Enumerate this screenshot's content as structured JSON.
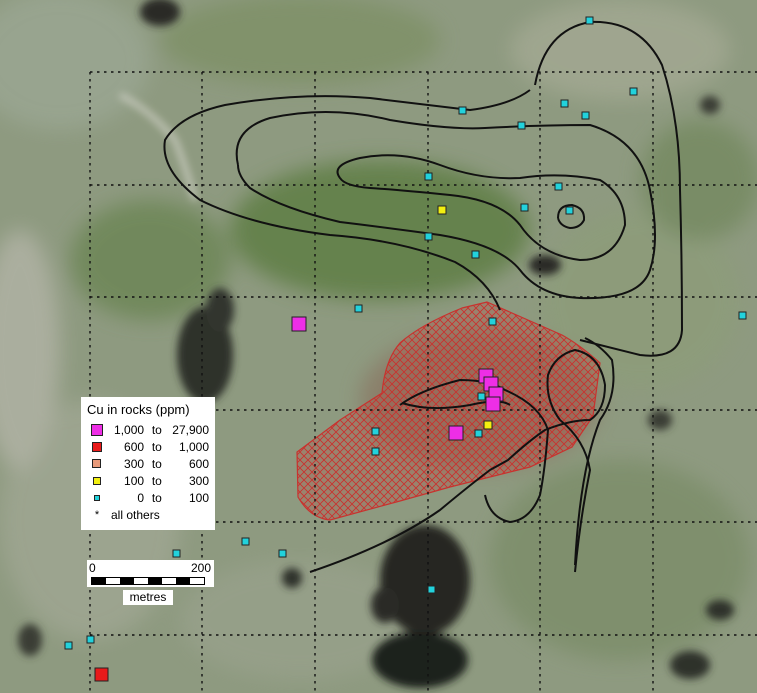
{
  "legend": {
    "title": "Cu in rocks (ppm)",
    "classes": [
      {
        "low": "1,000",
        "sep": "to",
        "high": "27,900",
        "color": "#ee2ee6"
      },
      {
        "low": "600",
        "sep": "to",
        "high": "1,000",
        "color": "#e81a1a"
      },
      {
        "low": "300",
        "sep": "to",
        "high": "600",
        "color": "#e89a7a"
      },
      {
        "low": "100",
        "sep": "to",
        "high": "300",
        "color": "#f2ef10"
      },
      {
        "low": "0",
        "sep": "to",
        "high": "100",
        "color": "#22d2dc"
      }
    ],
    "others_label": "all others"
  },
  "scale": {
    "start_label": "0",
    "end_label": "200",
    "unit": "metres"
  },
  "colors": {
    "contour": "#111111",
    "anomaly_fill": "#c8322e",
    "grid": "#111111"
  }
}
